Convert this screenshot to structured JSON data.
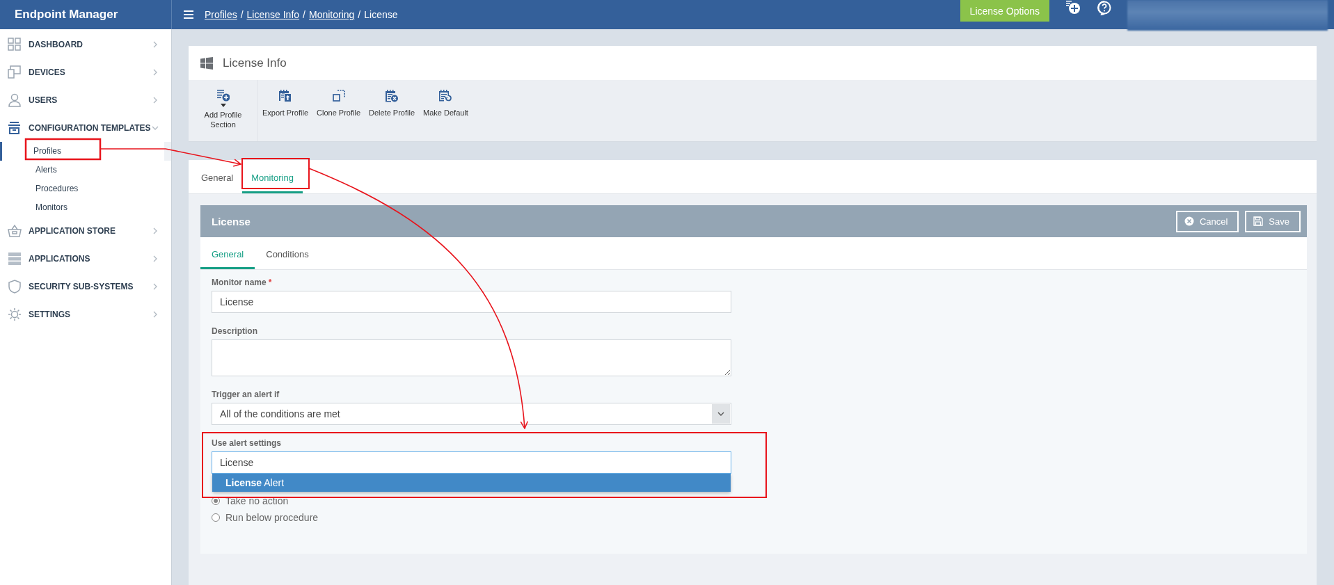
{
  "app": {
    "title": "Endpoint Manager"
  },
  "breadcrumbs": {
    "separator": "/",
    "items": [
      {
        "label": "Profiles",
        "link": true
      },
      {
        "label": "License Info",
        "link": true
      },
      {
        "label": "Monitoring",
        "link": true
      },
      {
        "label": "License",
        "link": false
      }
    ]
  },
  "header_button": "License Options",
  "sidebar": {
    "items": [
      {
        "label": "DASHBOARD",
        "expanded": false
      },
      {
        "label": "DEVICES",
        "expanded": false
      },
      {
        "label": "USERS",
        "expanded": false
      },
      {
        "label": "CONFIGURATION TEMPLATES",
        "expanded": true,
        "children": [
          {
            "label": "Profiles",
            "selected": true
          },
          {
            "label": "Alerts",
            "selected": false
          },
          {
            "label": "Procedures",
            "selected": false
          },
          {
            "label": "Monitors",
            "selected": false
          }
        ]
      },
      {
        "label": "APPLICATION STORE",
        "expanded": false
      },
      {
        "label": "APPLICATIONS",
        "expanded": false
      },
      {
        "label": "SECURITY SUB-SYSTEMS",
        "expanded": false
      },
      {
        "label": "SETTINGS",
        "expanded": false
      }
    ]
  },
  "profile": {
    "title": "License Info",
    "toolbar": [
      {
        "label": "Add Profile Section",
        "dropdown": true
      },
      {
        "label": "Export Profile",
        "dropdown": false
      },
      {
        "label": "Clone Profile",
        "dropdown": false
      },
      {
        "label": "Delete Profile",
        "dropdown": false
      },
      {
        "label": "Make Default",
        "dropdown": false
      }
    ],
    "tabs": [
      {
        "label": "General",
        "selected": false
      },
      {
        "label": "Monitoring",
        "selected": true
      }
    ]
  },
  "monitor": {
    "title": "License",
    "buttons": [
      {
        "label": "Cancel",
        "kind": "cancel"
      },
      {
        "label": "Save",
        "kind": "save"
      }
    ],
    "tabs": [
      {
        "label": "General",
        "selected": true
      },
      {
        "label": "Conditions",
        "selected": false
      }
    ],
    "fields": [
      {
        "kind": "text",
        "label": "Monitor name",
        "required_mark": "*",
        "value": "License"
      },
      {
        "kind": "textarea",
        "label": "Description"
      },
      {
        "kind": "select",
        "label": "Trigger an alert if",
        "value": "All of the conditions are met"
      },
      {
        "kind": "autocomplete",
        "label": "Use alert settings",
        "value": "License",
        "suggestions": [
          {
            "text": "**License** Alert",
            "selected": true
          }
        ]
      },
      {
        "kind": "radios",
        "options": [
          {
            "label": "Take no action",
            "selected": true
          },
          {
            "label": "Run below procedure",
            "selected": false
          }
        ]
      }
    ]
  }
}
